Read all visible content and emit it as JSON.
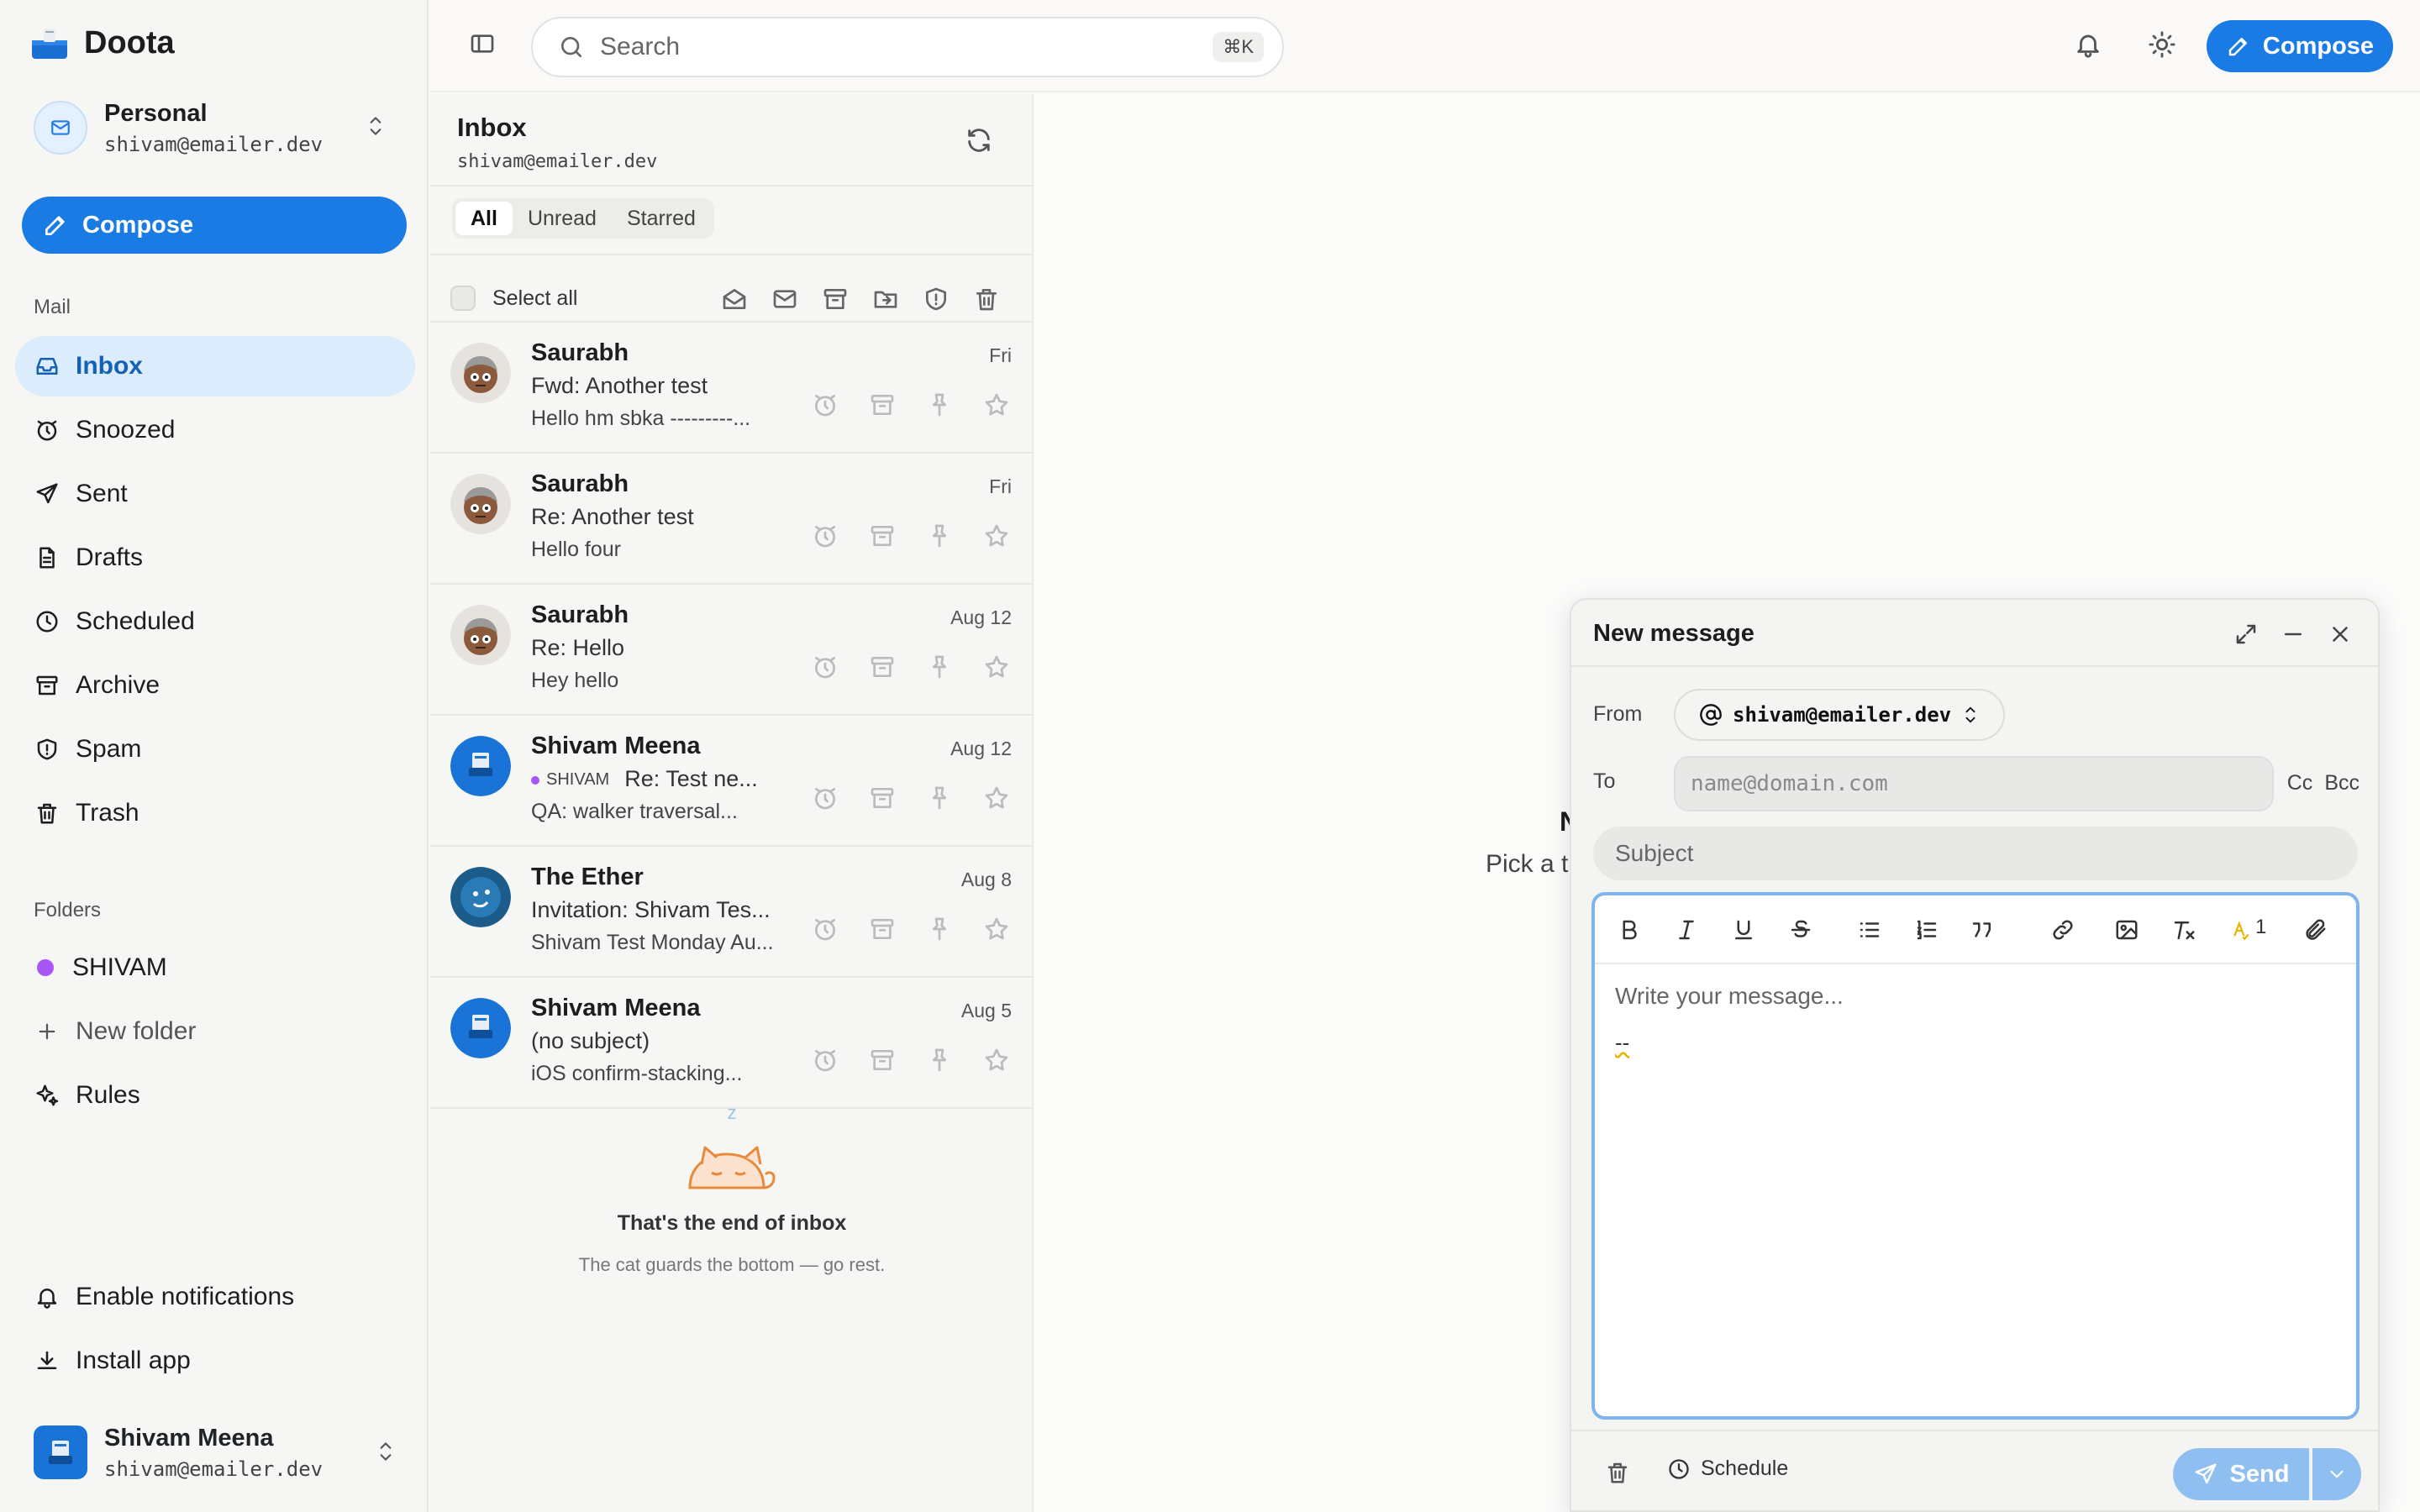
{
  "app": {
    "name": "Doota"
  },
  "account": {
    "name": "Personal",
    "email": "shivam@emailer.dev"
  },
  "sidebar": {
    "compose_label": "Compose",
    "mail_label": "Mail",
    "items": [
      {
        "label": "Inbox",
        "icon": "inbox-icon"
      },
      {
        "label": "Snoozed",
        "icon": "alarm-icon"
      },
      {
        "label": "Sent",
        "icon": "send-icon"
      },
      {
        "label": "Drafts",
        "icon": "file-icon"
      },
      {
        "label": "Scheduled",
        "icon": "clock-icon"
      },
      {
        "label": "Archive",
        "icon": "archive-icon"
      },
      {
        "label": "Spam",
        "icon": "shield-icon"
      },
      {
        "label": "Trash",
        "icon": "trash-icon"
      }
    ],
    "folders_label": "Folders",
    "folders": [
      {
        "label": "SHIVAM",
        "color": "#a855f7"
      }
    ],
    "new_folder_label": "New folder",
    "rules_label": "Rules",
    "enable_notifications_label": "Enable notifications",
    "install_app_label": "Install app"
  },
  "user": {
    "name": "Shivam Meena",
    "email": "shivam@emailer.dev"
  },
  "topbar": {
    "search_placeholder": "Search",
    "search_shortcut": "⌘K",
    "compose_label": "Compose"
  },
  "inbox": {
    "title": "Inbox",
    "email": "shivam@emailer.dev",
    "tabs": [
      "All",
      "Unread",
      "Starred"
    ],
    "active_tab": "All",
    "select_all_label": "Select all",
    "messages": [
      {
        "sender": "Saurabh",
        "date": "Fri",
        "subject": "Fwd: Another test",
        "snippet": "Hello hm sbka ---------...",
        "avatar": "cartoon"
      },
      {
        "sender": "Saurabh",
        "date": "Fri",
        "subject": "Re: Another test",
        "snippet": "Hello four",
        "avatar": "cartoon"
      },
      {
        "sender": "Saurabh",
        "date": "Aug 12",
        "subject": "Re: Hello",
        "snippet": "Hey hello",
        "avatar": "cartoon"
      },
      {
        "sender": "Shivam Meena",
        "date": "Aug 12",
        "tag": "SHIVAM",
        "subject": "Re: Test ne...",
        "snippet": "QA: walker traversal...",
        "avatar": "blue"
      },
      {
        "sender": "The Ether",
        "date": "Aug 8",
        "subject": "Invitation: Shivam Tes...",
        "snippet": "Shivam Test Monday Au...",
        "avatar": "ether"
      },
      {
        "sender": "Shivam Meena",
        "date": "Aug 5",
        "subject": "(no subject)",
        "snippet": "iOS confirm-stacking...",
        "avatar": "blue"
      }
    ],
    "end_z": "z",
    "end_title": "That's the end of inbox",
    "end_sub": "The cat guards the bottom — go rest."
  },
  "reader": {
    "empty_title_partial": "N",
    "empty_sub_partial": "Pick a t"
  },
  "compose": {
    "title": "New message",
    "from_label": "From",
    "from_value": "shivam@emailer.dev",
    "to_label": "To",
    "to_placeholder": "name@domain.com",
    "cc_label": "Cc",
    "bcc_label": "Bcc",
    "subject_placeholder": "Subject",
    "body_placeholder": "Write your message...",
    "signature": "--",
    "spellcheck_count": "1",
    "schedule_label": "Schedule",
    "send_label": "Send"
  },
  "colors": {
    "accent": "#1a7be4",
    "active_nav_bg": "#dbecfc",
    "folder_dot": "#a855f7"
  }
}
